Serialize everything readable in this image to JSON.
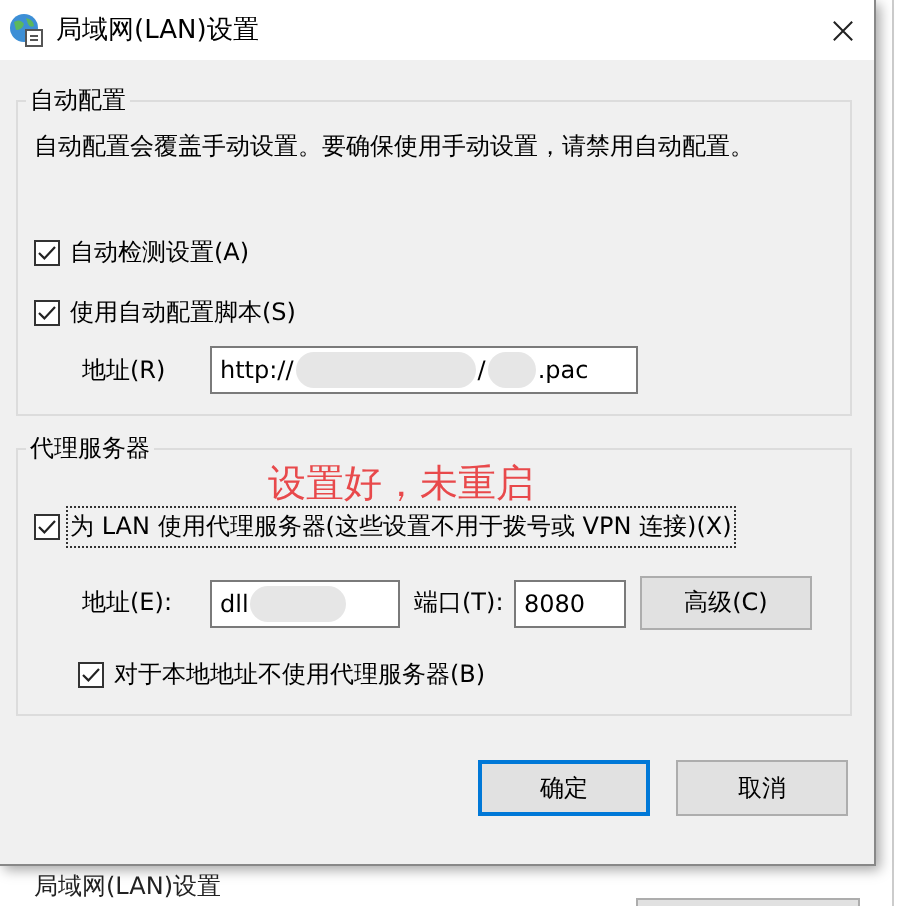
{
  "window": {
    "title": "局域网(LAN)设置"
  },
  "auto_config": {
    "title": "自动配置",
    "description": "自动配置会覆盖手动设置。要确保使用手动设置，请禁用自动配置。",
    "options": [
      {
        "label": "自动检测设置(A)",
        "checked": true
      },
      {
        "label": "使用自动配置脚本(S)",
        "checked": true
      }
    ],
    "address": {
      "label": "地址(R)",
      "value_parts": [
        "http://",
        "/",
        ".pac"
      ]
    }
  },
  "proxy": {
    "title": "代理服务器",
    "annotation": "设置好，未重启",
    "use_proxy": {
      "label": "为 LAN 使用代理服务器(这些设置不用于拨号或 VPN 连接)(X)",
      "checked": true,
      "focused": true
    },
    "address": {
      "label": "地址(E):",
      "value_parts": [
        "dll"
      ]
    },
    "port": {
      "label": "端口(T):",
      "value": "8080"
    },
    "advanced_button": "高级(C)",
    "bypass_local": {
      "label": "对于本地地址不使用代理服务器(B)",
      "checked": true
    }
  },
  "buttons": [
    {
      "label": "确定",
      "default": true
    },
    {
      "label": "取消",
      "default": false
    }
  ],
  "background_window": {
    "title": "局域网(LAN)设置"
  }
}
